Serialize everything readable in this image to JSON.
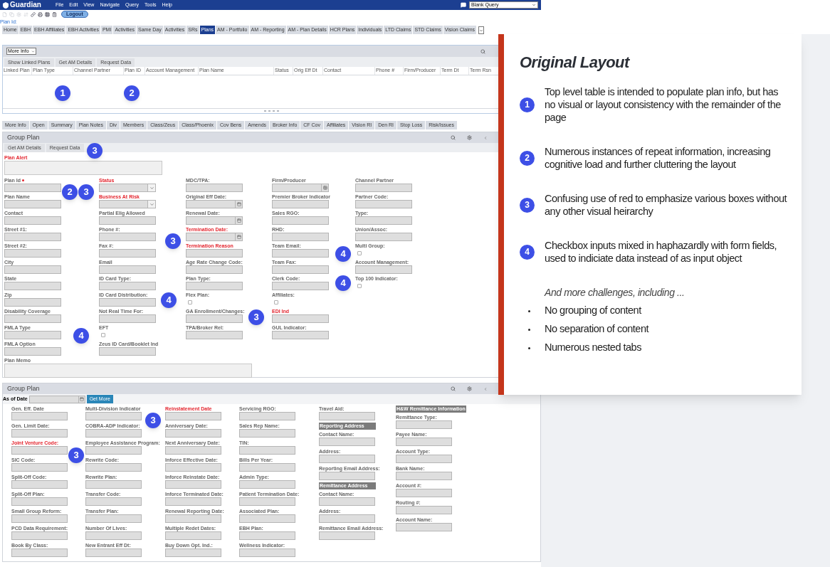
{
  "app": {
    "logo": "Guardian",
    "menu": [
      "File",
      "Edit",
      "View",
      "Navigate",
      "Query",
      "Tools",
      "Help"
    ],
    "query_select": "Blank Query",
    "logout": "Logout",
    "plan_id_link": "Plan Id:"
  },
  "main_tabs": [
    {
      "label": "Home",
      "selected": false
    },
    {
      "label": "EBH",
      "selected": false
    },
    {
      "label": "EBH Affiliates",
      "selected": false
    },
    {
      "label": "EBH Activities",
      "selected": false
    },
    {
      "label": "PMI",
      "selected": false
    },
    {
      "label": "Activities",
      "selected": false
    },
    {
      "label": "Same Day",
      "selected": false
    },
    {
      "label": "Activities",
      "selected": false
    },
    {
      "label": "SRs",
      "selected": false
    },
    {
      "label": "Plans",
      "selected": true
    },
    {
      "label": "AM - Portfolio",
      "selected": false
    },
    {
      "label": "AM - Reporting",
      "selected": false
    },
    {
      "label": "AM - Plan Details",
      "selected": false
    },
    {
      "label": "HCR Plans",
      "selected": false
    },
    {
      "label": "Individuals",
      "selected": false
    },
    {
      "label": "LTD Claims",
      "selected": false
    },
    {
      "label": "STD Claims",
      "selected": false
    },
    {
      "label": "Vision Claims",
      "selected": false
    }
  ],
  "linked_plans_panel": {
    "view_select": "More Info",
    "buttons": [
      "Show Linked Plans",
      "Get AM Details",
      "Request Data"
    ],
    "columns": [
      "Linked Plan",
      "Plan Type",
      "Channel Partner",
      "Plan ID",
      "Account Management",
      "Plan Name",
      "Status",
      "Orig Eff Dt",
      "Contact",
      "Phone #",
      "Firm/Producer",
      "Term Dt",
      "Term Rsn"
    ]
  },
  "plan_tabs": [
    {
      "label": "More Info",
      "selected": false
    },
    {
      "label": "Open",
      "selected": false
    },
    {
      "label": "Summary",
      "selected": false
    },
    {
      "label": "Plan Notes",
      "selected": false
    },
    {
      "label": "Div",
      "selected": false
    },
    {
      "label": "Members",
      "selected": false
    },
    {
      "label": "Class/Zeus",
      "selected": false
    },
    {
      "label": "Class/Phoenix",
      "selected": false
    },
    {
      "label": "Cov Bens",
      "selected": false
    },
    {
      "label": "Amends",
      "selected": false
    },
    {
      "label": "Broker Info",
      "selected": false
    },
    {
      "label": "CF Cov",
      "selected": false
    },
    {
      "label": "Affiliates",
      "selected": false
    },
    {
      "label": "Vision RI",
      "selected": false
    },
    {
      "label": "Den RI",
      "selected": false
    },
    {
      "label": "Stop Loss",
      "selected": false
    },
    {
      "label": "Risk/Issues",
      "selected": false
    }
  ],
  "group_plan": {
    "title": "Group Plan",
    "buttons": [
      "Get AM Details",
      "Request Data"
    ],
    "alert": {
      "label": "Plan Alert",
      "highlight": true
    },
    "columns": [
      [
        {
          "label": "Plan Id",
          "kind": "text",
          "highlight": false,
          "required": true
        },
        {
          "label": "Plan Name",
          "kind": "text",
          "highlight": false
        },
        {
          "label": "Contact",
          "kind": "text",
          "highlight": false
        },
        {
          "label": "Street #1:",
          "kind": "text",
          "highlight": false
        },
        {
          "label": "Street #2:",
          "kind": "text",
          "highlight": false
        },
        {
          "label": "City",
          "kind": "text",
          "highlight": false
        },
        {
          "label": "State",
          "kind": "text",
          "highlight": false
        },
        {
          "label": "Zip",
          "kind": "text",
          "highlight": false
        },
        {
          "label": "Disability Coverage",
          "kind": "text",
          "highlight": false
        },
        {
          "label": "FMLA Type",
          "kind": "text",
          "highlight": false
        },
        {
          "label": "FMLA Option",
          "kind": "text",
          "highlight": false
        }
      ],
      [
        {
          "label": "Status",
          "kind": "select",
          "highlight": true
        },
        {
          "label": "Business At Risk",
          "kind": "select",
          "highlight": true
        },
        {
          "label": "Partial Elig Allowed",
          "kind": "text",
          "highlight": false
        },
        {
          "label": "Phone #:",
          "kind": "text",
          "highlight": false
        },
        {
          "label": "Fax #:",
          "kind": "text",
          "highlight": false
        },
        {
          "label": "Email",
          "kind": "text",
          "highlight": false
        },
        {
          "label": "ID Card Type:",
          "kind": "text",
          "highlight": false
        },
        {
          "label": "ID Card Distribution:",
          "kind": "text",
          "highlight": false
        },
        {
          "label": "Not Real Time For:",
          "kind": "text",
          "highlight": false
        },
        {
          "label": "EFT",
          "kind": "checkbox",
          "highlight": false,
          "checked": false
        },
        {
          "label": "Zeus ID Card/Booklet Ind",
          "kind": "text",
          "highlight": false
        }
      ],
      [
        {
          "label": "MDC/TPA:",
          "kind": "text",
          "highlight": false
        },
        {
          "label": "Original Eff Date:",
          "kind": "date",
          "highlight": false
        },
        {
          "label": "Renewal Date:",
          "kind": "date",
          "highlight": false
        },
        {
          "label": "Termination Date:",
          "kind": "date",
          "highlight": true
        },
        {
          "label": "Termination Reason",
          "kind": "text",
          "highlight": true
        },
        {
          "label": "Age Rate Change Code:",
          "kind": "text",
          "highlight": false
        },
        {
          "label": "Plan Type:",
          "kind": "text",
          "highlight": false
        },
        {
          "label": "Flex Plan:",
          "kind": "checkbox",
          "highlight": false,
          "checked": false
        },
        {
          "label": "GA Enrollment/Changes:",
          "kind": "text",
          "highlight": false
        },
        {
          "label": "TPA/Broker Rel:",
          "kind": "text",
          "highlight": false
        }
      ],
      [
        {
          "label": "Firm/Producer",
          "kind": "lookup",
          "highlight": false
        },
        {
          "label": "Premier Broker Indicator",
          "kind": "text",
          "highlight": false
        },
        {
          "label": "Sales RGO:",
          "kind": "text",
          "highlight": false
        },
        {
          "label": "RHD:",
          "kind": "text",
          "highlight": false
        },
        {
          "label": "Team Email:",
          "kind": "text",
          "highlight": false
        },
        {
          "label": "Team Fax:",
          "kind": "text",
          "highlight": false
        },
        {
          "label": "Clerk Code:",
          "kind": "text",
          "highlight": false
        },
        {
          "label": "Affiliates:",
          "kind": "checkbox",
          "highlight": false,
          "checked": false
        },
        {
          "label": "EDI Ind",
          "kind": "text",
          "highlight": true
        },
        {
          "label": "GUL Indicator:",
          "kind": "text",
          "highlight": false
        }
      ],
      [
        {
          "label": "Channel Partner",
          "kind": "text",
          "highlight": false
        },
        {
          "label": "Partner Code:",
          "kind": "text",
          "highlight": false
        },
        {
          "label": "Type:",
          "kind": "text",
          "highlight": false
        },
        {
          "label": "Union/Assoc:",
          "kind": "text",
          "highlight": false
        },
        {
          "label": "Multi Group:",
          "kind": "checkbox",
          "highlight": false,
          "checked": false
        },
        {
          "label": "Account Management:",
          "kind": "text",
          "highlight": false
        },
        {
          "label": "Top 100 Indicator:",
          "kind": "checkbox",
          "highlight": false,
          "checked": false
        }
      ]
    ],
    "memo_label": "Plan Memo"
  },
  "group_plan_2": {
    "title": "Group Plan",
    "as_of_label": "As of Date",
    "get_more": "Get More",
    "columns": [
      [
        {
          "label": "Gen. Eff. Date",
          "kind": "text",
          "highlight": false
        },
        {
          "label": "Gen. Limit Date:",
          "kind": "text",
          "highlight": false
        },
        {
          "label": "Joint Venture Code:",
          "kind": "text",
          "highlight": true
        },
        {
          "label": "SIC Code:",
          "kind": "text",
          "highlight": false
        },
        {
          "label": "Split-Off Code:",
          "kind": "text",
          "highlight": false
        },
        {
          "label": "Split-Off Plan:",
          "kind": "text",
          "highlight": false
        },
        {
          "label": "Small Group Reform:",
          "kind": "text",
          "highlight": false
        },
        {
          "label": "PCD Data Requirement:",
          "kind": "text",
          "highlight": false
        },
        {
          "label": "Book By Class:",
          "kind": "text",
          "highlight": false
        }
      ],
      [
        {
          "label": "Multi-Division Indicator",
          "kind": "text",
          "highlight": false
        },
        {
          "label": "COBRA-ADP Indicator:",
          "kind": "text",
          "highlight": false
        },
        {
          "label": "Employee Assistance Program:",
          "kind": "text",
          "highlight": false
        },
        {
          "label": "Rewrite Code:",
          "kind": "text",
          "highlight": false
        },
        {
          "label": "Rewrite Plan:",
          "kind": "text",
          "highlight": false
        },
        {
          "label": "Transfer Code:",
          "kind": "text",
          "highlight": false
        },
        {
          "label": "Transfer Plan:",
          "kind": "text",
          "highlight": false
        },
        {
          "label": "Number Of Lives:",
          "kind": "text",
          "highlight": false
        },
        {
          "label": "New Entrant Eff Dt:",
          "kind": "text",
          "highlight": false
        }
      ],
      [
        {
          "label": "Reinstatement Date",
          "kind": "text",
          "highlight": true
        },
        {
          "label": "Anniversary Date:",
          "kind": "text",
          "highlight": false
        },
        {
          "label": "Next Anniversary Date:",
          "kind": "text",
          "highlight": false
        },
        {
          "label": "Inforce Effective Date:",
          "kind": "text",
          "highlight": false
        },
        {
          "label": "Inforce Reinstate Date:",
          "kind": "text",
          "highlight": false
        },
        {
          "label": "Inforce Terminated Date:",
          "kind": "text",
          "highlight": false
        },
        {
          "label": "Renewal Reporting Date:",
          "kind": "text",
          "highlight": false
        },
        {
          "label": "Multiple Redet Dates:",
          "kind": "text",
          "highlight": false
        },
        {
          "label": "Buy Down Opt. Ind.:",
          "kind": "text",
          "highlight": false
        }
      ],
      [
        {
          "label": "Servicing RGO:",
          "kind": "text",
          "highlight": false
        },
        {
          "label": "Sales Rep Name:",
          "kind": "text",
          "highlight": false
        },
        {
          "label": "TIN:",
          "kind": "text",
          "highlight": false
        },
        {
          "label": "Bills Per Year:",
          "kind": "text",
          "highlight": false
        },
        {
          "label": "Admin Type:",
          "kind": "text",
          "highlight": false
        },
        {
          "label": "Patient Termination Date:",
          "kind": "text",
          "highlight": false
        },
        {
          "label": "Associated Plan:",
          "kind": "text",
          "highlight": false
        },
        {
          "label": "EBH Plan:",
          "kind": "text",
          "highlight": false
        },
        {
          "label": "Wellness Indicator:",
          "kind": "text",
          "highlight": false
        }
      ],
      [
        {
          "label": "Travel Aid:",
          "kind": "text",
          "highlight": false
        },
        {
          "label": "Reporting Address",
          "kind": "heading"
        },
        {
          "label": "Contact Name:",
          "kind": "text",
          "highlight": false
        },
        {
          "label": "Address:",
          "kind": "text",
          "highlight": false
        },
        {
          "label": "Reporting Email Address:",
          "kind": "text",
          "highlight": false
        },
        {
          "label": "Remittance Address",
          "kind": "heading"
        },
        {
          "label": "Contact Name:",
          "kind": "text",
          "highlight": false
        },
        {
          "label": "Address:",
          "kind": "text",
          "highlight": false
        },
        {
          "label": "Remittance Email Address:",
          "kind": "text",
          "highlight": false
        }
      ],
      [
        {
          "label": "H&W Remittance Information",
          "kind": "heading"
        },
        {
          "label": "Remittance Type:",
          "kind": "text",
          "highlight": false
        },
        {
          "label": "Payee Name:",
          "kind": "text",
          "highlight": false
        },
        {
          "label": "Account Type:",
          "kind": "text",
          "highlight": false
        },
        {
          "label": "Bank Name:",
          "kind": "text",
          "highlight": false
        },
        {
          "label": "Account #:",
          "kind": "text",
          "highlight": false
        },
        {
          "label": "Routing #:",
          "kind": "text",
          "highlight": false
        },
        {
          "label": "Account Name:",
          "kind": "text",
          "highlight": false
        }
      ]
    ]
  },
  "callouts": [
    "1",
    "2",
    "3",
    "2",
    "3",
    "3",
    "4",
    "4",
    "4",
    "3",
    "4",
    "3",
    "3"
  ],
  "notes_card": {
    "title": "Original Layout",
    "items": [
      {
        "number": "1",
        "text": "Top level table is intended to populate plan info, but has no visual or layout consistency with the remainder of the page"
      },
      {
        "number": "2",
        "text": "Numerous instances of repeat information, increasing cognitive load and further cluttering the layout"
      },
      {
        "number": "3",
        "text": "Confusing use of red to emphasize various boxes without any other visual heirarchy"
      },
      {
        "number": "4",
        "text": "Checkbox inputs mixed in haphazardly with form fields, used to indiciate data instead of as input object"
      }
    ],
    "more_heading": "And more challenges, including ...",
    "bullets": [
      "No grouping of content",
      "No separation of content",
      "Numerous nested tabs"
    ]
  }
}
